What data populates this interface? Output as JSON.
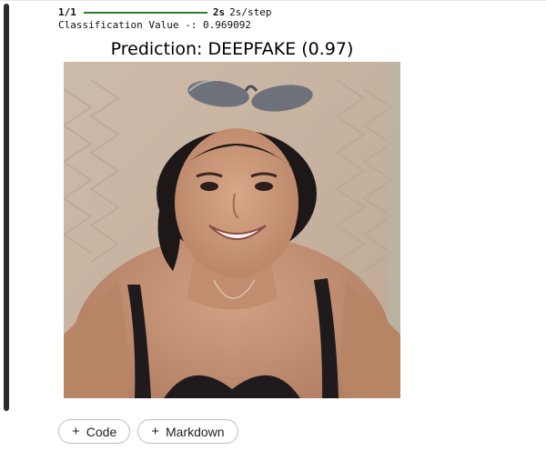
{
  "output": {
    "progress": {
      "step": "1/1",
      "time": "2s",
      "rate": "2s/step",
      "fraction": 1.0
    },
    "classification": {
      "label": "Classification Value -:",
      "value": "0.969092"
    },
    "figure": {
      "title": "Prediction: DEEPFAKE (0.97)"
    }
  },
  "add_cell": {
    "code_label": "Code",
    "markdown_label": "Markdown",
    "icon": "plus-icon"
  },
  "colors": {
    "progress_bar": "#2e7d32",
    "cell_bar": "#2b2b2b",
    "button_border": "#bdbdbd"
  }
}
